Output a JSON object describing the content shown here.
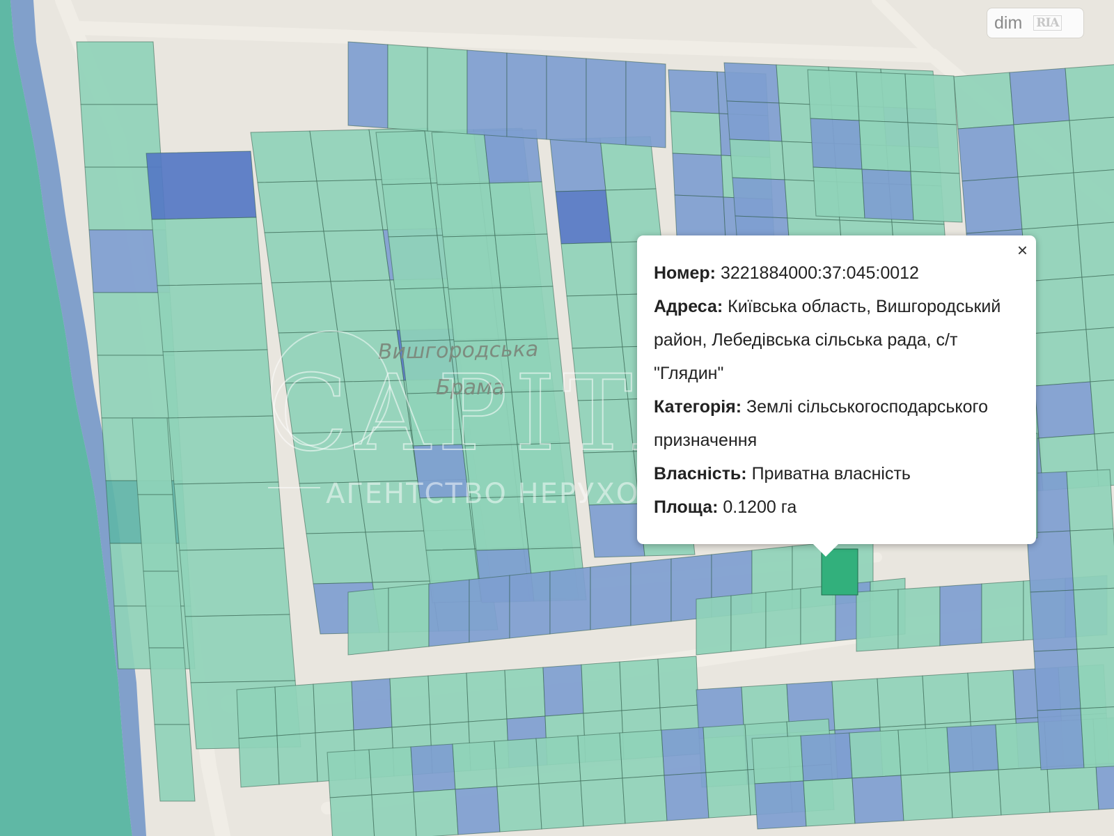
{
  "map": {
    "area_label_line1": "Вишгородська",
    "area_label_line2": "Брама",
    "watermark_main": "CAPITAL",
    "watermark_sub": "АГЕНТСТВО НЕРУХОМОСТІ",
    "colors": {
      "background": "#e9e6df",
      "road": "#f0ede6",
      "water": "#5fb8a5",
      "parcel_green": "#8fd3b8",
      "parcel_blue": "#7e9ed0",
      "parcel_dark_blue": "#5578c4",
      "parcel_teal": "#5fb5a8",
      "selected_parcel": "#32b07c"
    }
  },
  "popup": {
    "close_symbol": "×",
    "fields": [
      {
        "label": "Номер:",
        "value": " 3221884000:37:045:0012"
      },
      {
        "label": "Адреса:",
        "value": " Київська область, Вишгородський район, Лебедівська сільська рада, с/т \"Глядин\""
      },
      {
        "label": "Категорія:",
        "value": " Землі сільськогосподарського призначення"
      },
      {
        "label": "Власність:",
        "value": " Приватна власність"
      },
      {
        "label": "Площа:",
        "value": " 0.1200 га"
      }
    ]
  },
  "logo": {
    "brand": "dim",
    "sub": "RIA"
  }
}
